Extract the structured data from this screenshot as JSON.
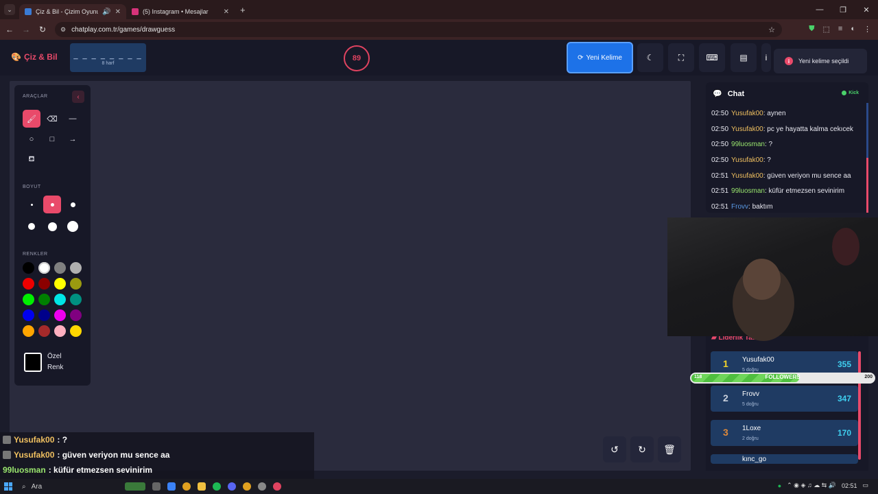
{
  "browser": {
    "tabs": [
      {
        "title": "Çiz & Bil - Çizim Oyunu",
        "active": true
      },
      {
        "title": "(5) Instagram • Mesajlar",
        "active": false
      }
    ],
    "url": "chatplay.com.tr/games/drawguess"
  },
  "header": {
    "logo": "Çiz & Bil",
    "word_pattern": "_ _ _ _ _ _ _ _",
    "word_hint": "8 harf",
    "timer": "89",
    "new_word_label": "Yeni Kelime",
    "toast": "Yeni kelime seçildi",
    "toast_icon": "i"
  },
  "tools": {
    "section_tools": "ARAÇLAR",
    "section_size": "BOYUT",
    "section_colors": "RENKLER",
    "custom_color_label": "Özel Renk",
    "colors": [
      "#000000",
      "#ffffff",
      "#808080",
      "#b0b0b0",
      "#ee0000",
      "#8b0000",
      "#ffff00",
      "#9a9a10",
      "#00ee00",
      "#008000",
      "#00e5e5",
      "#009080",
      "#0000ee",
      "#00008b",
      "#ee00ee",
      "#800080",
      "#ffa500",
      "#a52a2a",
      "#ffb0c0",
      "#ffd700"
    ]
  },
  "overlay_chat": [
    {
      "user": "Yusufak00",
      "text": ": ?",
      "color": "#f0c060"
    },
    {
      "user": "Yusufak00",
      "text": ": güven veriyon mu sence aa",
      "color": "#f0c060"
    },
    {
      "user": "99luosman",
      "text": ": küfür etmezsen sevinirim",
      "color": "#9ae66e"
    }
  ],
  "chat": {
    "title": "Chat",
    "platform": "Kick",
    "messages": [
      {
        "time": "02:50",
        "user": "Yusufak00",
        "text": ": aynen"
      },
      {
        "time": "02:50",
        "user": "Yusufak00",
        "text": ": pc ye hayatta kalma cekıcek"
      },
      {
        "time": "02:50",
        "user": "99luosman",
        "text": ": ?"
      },
      {
        "time": "02:50",
        "user": "Yusufak00",
        "text": ": ?"
      },
      {
        "time": "02:51",
        "user": "Yusufak00",
        "text": ": güven veriyon mu sence aa"
      },
      {
        "time": "02:51",
        "user": "99luosman",
        "text": ": küfür etmezsen sevinirim"
      },
      {
        "time": "02:51",
        "user": "Frovv",
        "text": ": baktım"
      }
    ]
  },
  "leaderboard": {
    "title": "Liderlik Tablosu",
    "rows": [
      {
        "rank": "1",
        "name": "Yusufak00",
        "sub": "5 doğru",
        "score": "355",
        "rank_color": "#f2d32a"
      },
      {
        "rank": "2",
        "name": "Frovv",
        "sub": "5 doğru",
        "score": "347",
        "rank_color": "#c9d0dc"
      },
      {
        "rank": "3",
        "name": "1Loxe",
        "sub": "2 doğru",
        "score": "170",
        "rank_color": "#e08a3a"
      },
      {
        "rank": "",
        "name": "kınc_go",
        "sub": "",
        "score": "",
        "rank_color": "#c9d0dc"
      }
    ],
    "followers": {
      "label": "FOLLOWERS",
      "current": "118",
      "goal": "200",
      "progress": 0.59
    }
  },
  "taskbar": {
    "search_placeholder": "Ara",
    "time": "02:51"
  }
}
